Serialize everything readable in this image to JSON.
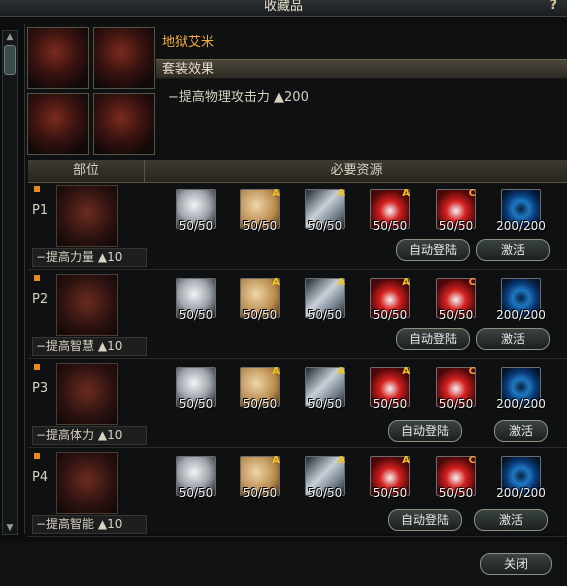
{
  "window": {
    "title": "收藏品",
    "help": "?"
  },
  "item": {
    "name": "地狱艾米"
  },
  "set_effect": {
    "header": "套装效果",
    "line": "−提高物理攻击力 ▲200"
  },
  "columns": {
    "part": "部位",
    "resources": "必要资源"
  },
  "resources": [
    {
      "icon": "white-ore-icon",
      "cls": "ore",
      "grade": ""
    },
    {
      "icon": "leather-icon",
      "cls": "leather",
      "grade": "A"
    },
    {
      "icon": "cloth-icon",
      "cls": "cloth",
      "grade": "A"
    },
    {
      "icon": "potion-icon",
      "cls": "potion-red",
      "grade": "A"
    },
    {
      "icon": "potion-icon",
      "cls": "potion-red",
      "grade": "C"
    },
    {
      "icon": "vortex-icon",
      "cls": "vortex",
      "grade": ""
    }
  ],
  "rows": [
    {
      "label": "P1",
      "stat": "−提高力量 ▲10",
      "counts": [
        "50/50",
        "50/50",
        "50/50",
        "50/50",
        "50/50",
        "200/200"
      ],
      "auto": "自动登陆",
      "activate": "激活"
    },
    {
      "label": "P2",
      "stat": "−提高智慧 ▲10",
      "counts": [
        "50/50",
        "50/50",
        "50/50",
        "50/50",
        "50/50",
        "200/200"
      ],
      "auto": "自动登陆",
      "activate": "激活"
    },
    {
      "label": "P3",
      "stat": "−提高体力 ▲10",
      "counts": [
        "50/50",
        "50/50",
        "50/50",
        "50/50",
        "50/50",
        "200/200"
      ],
      "auto": "自动登陆",
      "activate": "激活"
    },
    {
      "label": "P4",
      "stat": "−提高智能 ▲10",
      "counts": [
        "50/50",
        "50/50",
        "50/50",
        "50/50",
        "50/50",
        "200/200"
      ],
      "auto": "自动登陆",
      "activate": "激活"
    }
  ],
  "footer": {
    "close": "关闭"
  }
}
